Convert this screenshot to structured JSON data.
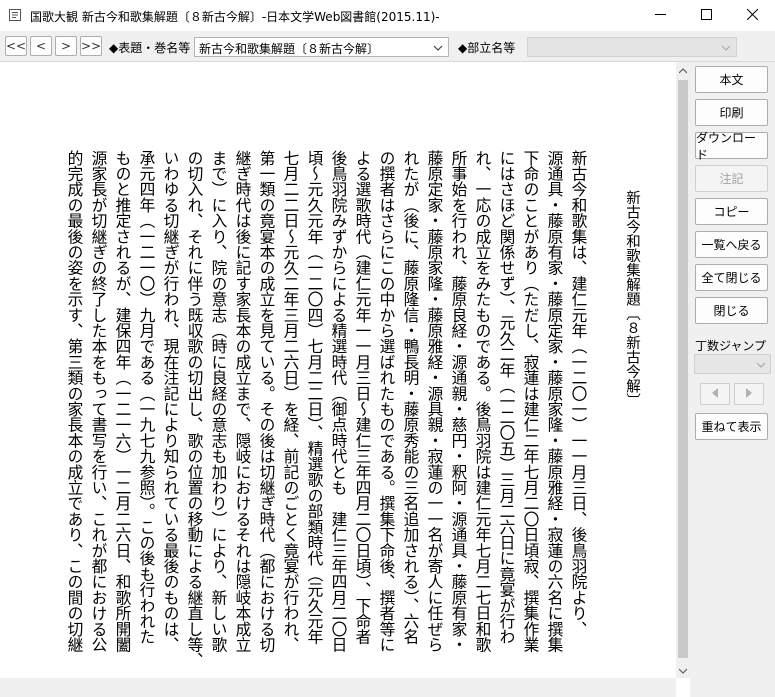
{
  "window": {
    "title": "国歌大観 新古今和歌集解題〔８新古今解〕-日本文学Web図書館(2015.11)-",
    "controls": [
      "minimize-icon",
      "maximize-icon",
      "close-icon"
    ]
  },
  "toolbar": {
    "nav_first": "<<",
    "nav_prev": "<",
    "nav_next": ">",
    "nav_last": ">>",
    "label_title": "◆表題・巻名等",
    "title_select_value": "新古今和歌集解題〔８新古今解〕",
    "label_section": "◆部立名等",
    "section_select_value": ""
  },
  "document": {
    "title": "新古今和歌集解題〔８新古今解〕",
    "columns": [
      "新古今和歌集は、建仁元年（一二〇一）一一月三日、後鳥羽院より、",
      "源通具・藤原有家・藤原定家・藤原家隆・藤原雅経・寂蓮の六名に撰集",
      "下命のことがあり（ただし、寂蓮は建仁二年七月二〇日頃寂、撰集作業",
      "にはさほど関係せず）、元久二年（一二〇五）三月二六日に竟宴が行わ",
      "れ、一応の成立をみたものである。後鳥羽院は建仁元年七月二七日和歌",
      "所事始を行われ、藤原良経・源通親・慈円・釈阿・源通具・藤原有家・",
      "藤原定家・藤原家隆・藤原雅経・源具親・寂蓮の一一名が寄人に任ぜら",
      "れたが（後に、藤原隆信・鴨長明・藤原秀能の三名追加される）、六名",
      "の撰者はさらにこの中から選ばれたものである。撰集下命後、撰者等に",
      "よる選歌時代（建仁元年一一月三日～建仁三年四月二〇日頃）、下命者",
      "後鳥羽院みずからによる精選時代（御点時代とも　建仁三年四月二〇日",
      "頃～元久元年（一二〇四）七月二二日）、精選歌の部類時代（元久元年",
      "七月二二日～元久二年三月二六日）を経、前記のごとく竟宴が行われ、",
      "第一類の竟宴本の成立を見ている。その後は切継ぎ時代（都における切",
      "継ぎ時代は後に記す家長本の成立まで、隠岐におけるそれは隠岐本成立",
      "まで）に入り、院の意志（時に良経の意志も加わり）により、新しい歌",
      "の切入れ、それに伴う既収歌の切出し、歌の位置の移動による継直し等、",
      "いわゆる切継ぎが行われ、現在注記により知られている最後のものは、",
      "承元四年（一二一〇）九月である（一九七九参照）。この後も行われた",
      "ものと推定されるが、建保四年（一二一六）一二月二六日、和歌所開闔",
      "源家長が切継ぎの終了した本をもって書写を行い、これが都における公",
      "的完成の最後の姿を示す、第三類の家長本の成立であり、この間の切継"
    ]
  },
  "side_panel": {
    "buttons": [
      {
        "label": "本文",
        "enabled": true
      },
      {
        "label": "印刷",
        "enabled": true
      },
      {
        "label": "ダウンロード",
        "enabled": true
      },
      {
        "label": "注記",
        "enabled": false
      },
      {
        "label": "コピー",
        "enabled": true
      },
      {
        "label": "一覧へ戻る",
        "enabled": true
      },
      {
        "label": "全て閉じる",
        "enabled": true
      },
      {
        "label": "閉じる",
        "enabled": true
      }
    ],
    "jump_label": "丁数ジャンプ",
    "jump_value": "",
    "overlay_button": "重ねて表示"
  }
}
